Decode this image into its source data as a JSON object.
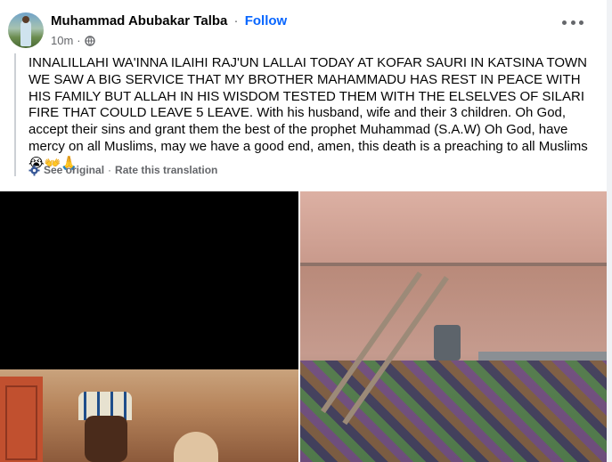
{
  "post": {
    "author": "Muhammad Abubakar Talba",
    "separator": "·",
    "follow_label": "Follow",
    "time": "10m",
    "time_separator": "·",
    "text": "INNALILLAHI WA'INNA ILAIHI RAJ'UN LALLAI TODAY AT KOFAR SAURI IN KATSINA TOWN WE SAW A BIG SERVICE THAT MY BROTHER MAHAMMADU HAS REST IN PEACE WITH HIS FAMILY BUT ALLAH IN HIS WISDOM TESTED THEM WITH THE ELSELVES OF SILARI FIRE THAT COULD LEAVE 5 LEAVE. With his husband, wife and their 3 children. Oh God, accept their sins and grant them the best of the prophet Muhammad (S.A.W) Oh God, have mercy on all Muslims, may we have a good end, amen, this death is a preaching to all Muslims😭👐🙏",
    "see_original": "See original",
    "link_separator": "·",
    "rate_translation": "Rate this translation"
  },
  "icons": {
    "privacy": "globe-icon",
    "translation": "gear-icon",
    "menu": "more-options-icon"
  },
  "colors": {
    "follow": "#0866ff",
    "secondary_text": "#65676b",
    "page_background": "#f0f2f5"
  }
}
